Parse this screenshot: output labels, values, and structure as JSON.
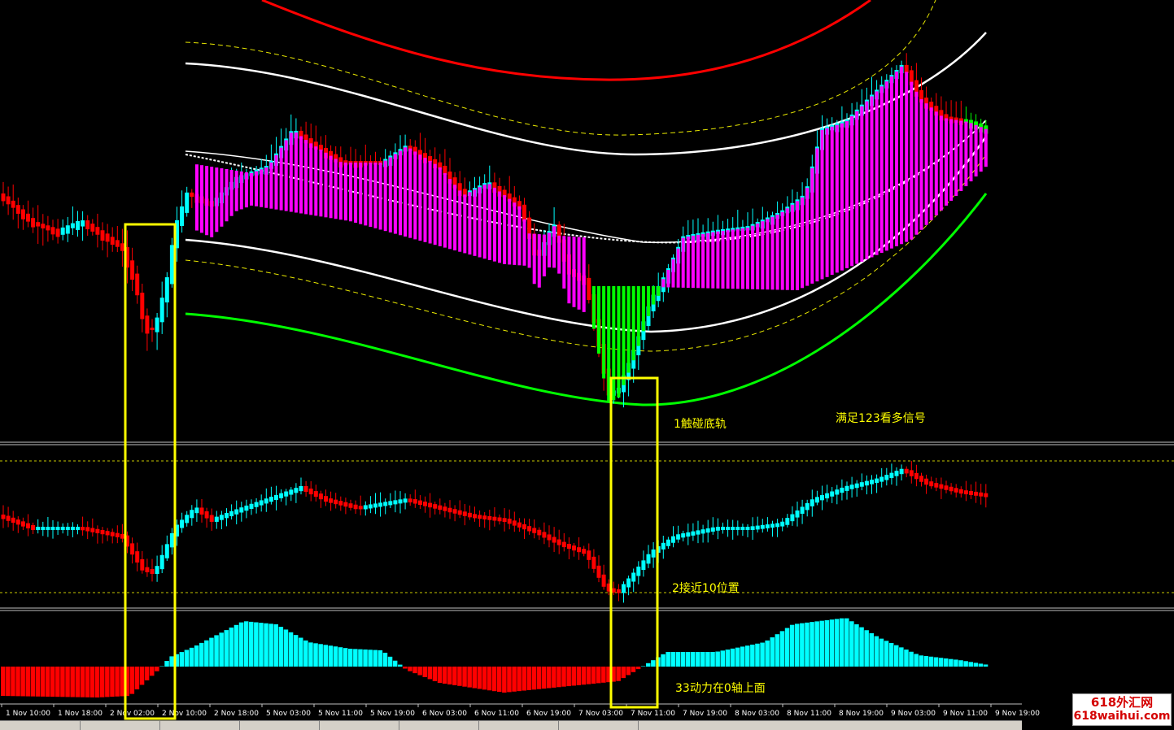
{
  "chart_data": {
    "type": "candlestick",
    "x_ticks": [
      "1 Nov 10:00",
      "1 Nov 18:00",
      "2 Nov 02:00",
      "2 Nov 10:00",
      "2 Nov 18:00",
      "5 Nov 03:00",
      "5 Nov 11:00",
      "5 Nov 19:00",
      "6 Nov 03:00",
      "6 Nov 11:00",
      "6 Nov 19:00",
      "7 Nov 03:00",
      "7 Nov 11:00",
      "7 Nov 19:00",
      "8 Nov 03:00",
      "8 Nov 11:00",
      "8 Nov 19:00",
      "9 Nov 03:00",
      "9 Nov 11:00",
      "9 Nov 19:00"
    ],
    "annotations": [
      "1触碰底轨",
      "满足123看多信号",
      "2接近10位置",
      "33动力在0轴上面"
    ],
    "panels": [
      "price with channel bands",
      "oscillator",
      "momentum histogram"
    ],
    "colors": {
      "bull": "#00ffff",
      "bear": "#ff0000",
      "magenta": "#ff00ff",
      "green": "#00ff00",
      "band_upper": "#ff0000",
      "band_lower": "#00ff00",
      "band_mid": "#ffffff",
      "band_dash": "#ffff00",
      "highlight_box": "#ffff00",
      "annotation": "#ffff00"
    }
  },
  "watermark": {
    "line1": "618外汇网",
    "line2": "618waihui.com"
  }
}
